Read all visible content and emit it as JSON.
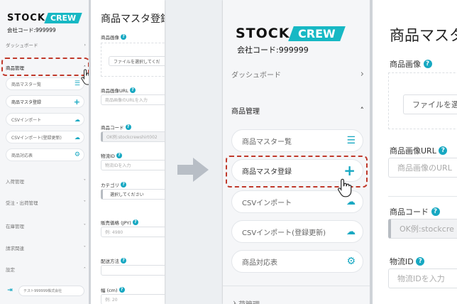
{
  "logo": {
    "stock": "STOCK",
    "crew": "CREW"
  },
  "company_code": "会社コード:999999",
  "sidebar": {
    "dashboard": "ダッシュボード",
    "product_mgmt": "商品管理",
    "items": [
      {
        "label": "商品マスター覧",
        "icon": "list-icon"
      },
      {
        "label": "商品マスタ登録",
        "icon": "plus-icon"
      },
      {
        "label": "CSVインポート",
        "icon": "upload-icon"
      },
      {
        "label": "CSVインポート(登録更新)",
        "icon": "upload-icon"
      },
      {
        "label": "商品対応表",
        "icon": "gear-icon"
      }
    ],
    "sections": [
      "入荷管理",
      "受注・出荷管理",
      "在庫管理",
      "請求関連",
      "設定"
    ],
    "partial_section": "入荷管理",
    "footer_company": "テスト999999株式会社"
  },
  "main": {
    "title": "商品マスタ登録",
    "title_clipped": "商品マスタ",
    "fields": {
      "image": {
        "label": "商品画像",
        "button": "ファイルを選択してくだ",
        "button_clipped": "ファイルを選"
      },
      "image_url": {
        "label": "商品画像URL",
        "placeholder": "商品画像のURLを入力",
        "placeholder_clipped": "商品画像のURL"
      },
      "code": {
        "label": "商品コード",
        "placeholder": "OK例:stockcrewshirt002",
        "placeholder_clipped": "OK例:stockcre"
      },
      "logistics_id": {
        "label": "物流ID",
        "placeholder": "物流IDを入力",
        "placeholder_clipped": "物流IDを入力"
      },
      "category": {
        "label": "カテゴリ",
        "value": "選択してください"
      },
      "price": {
        "label": "販売価格 (JPY)",
        "placeholder": "例: 4980"
      },
      "shipping": {
        "label": "配送方法"
      },
      "width": {
        "label": "幅 (cm)",
        "placeholder": "例: 20"
      }
    }
  },
  "colors": {
    "accent": "#17a8c2",
    "highlight": "#c0392b",
    "arrow": "#b8bec6"
  }
}
